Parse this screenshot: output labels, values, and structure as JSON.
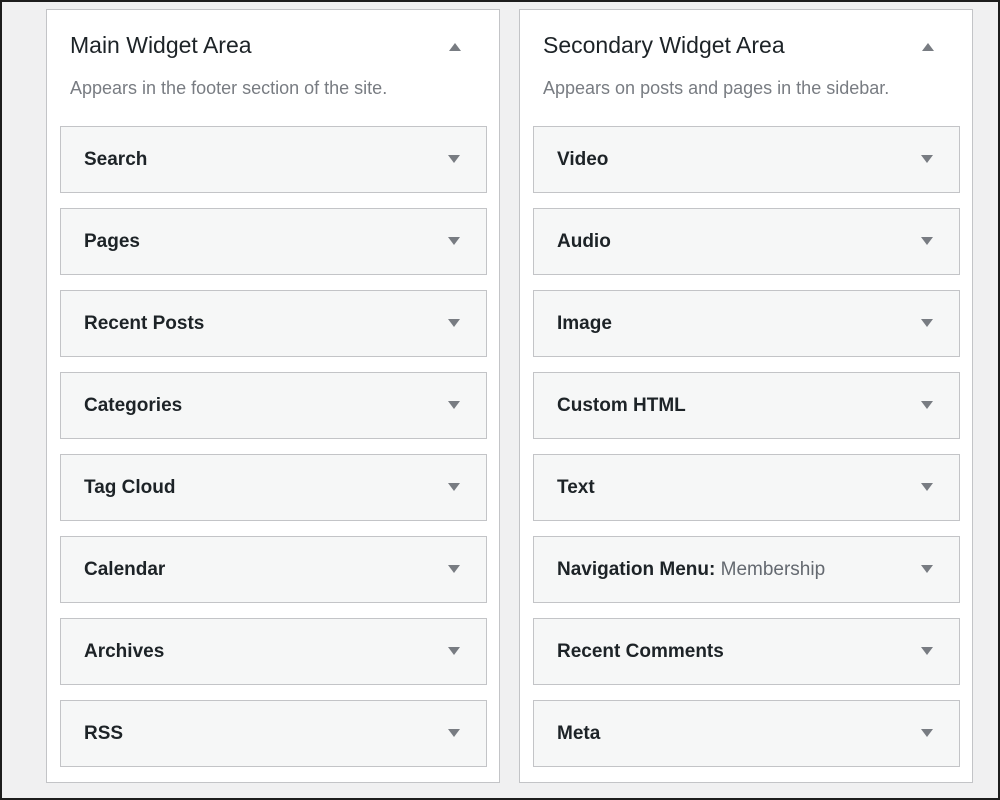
{
  "main_area": {
    "title": "Main Widget Area",
    "description": "Appears in the footer section of the site.",
    "widgets": [
      {
        "title": "Search",
        "subtitle": ""
      },
      {
        "title": "Pages",
        "subtitle": ""
      },
      {
        "title": "Recent Posts",
        "subtitle": ""
      },
      {
        "title": "Categories",
        "subtitle": ""
      },
      {
        "title": "Tag Cloud",
        "subtitle": ""
      },
      {
        "title": "Calendar",
        "subtitle": ""
      },
      {
        "title": "Archives",
        "subtitle": ""
      },
      {
        "title": "RSS",
        "subtitle": ""
      }
    ]
  },
  "secondary_area": {
    "title": "Secondary Widget Area",
    "description": "Appears on posts and pages in the sidebar.",
    "widgets": [
      {
        "title": "Video",
        "subtitle": ""
      },
      {
        "title": "Audio",
        "subtitle": ""
      },
      {
        "title": "Image",
        "subtitle": ""
      },
      {
        "title": "Custom HTML",
        "subtitle": ""
      },
      {
        "title": "Text",
        "subtitle": ""
      },
      {
        "title": "Navigation Menu:",
        "subtitle": " Membership"
      },
      {
        "title": "Recent Comments",
        "subtitle": ""
      },
      {
        "title": "Meta",
        "subtitle": ""
      }
    ]
  }
}
